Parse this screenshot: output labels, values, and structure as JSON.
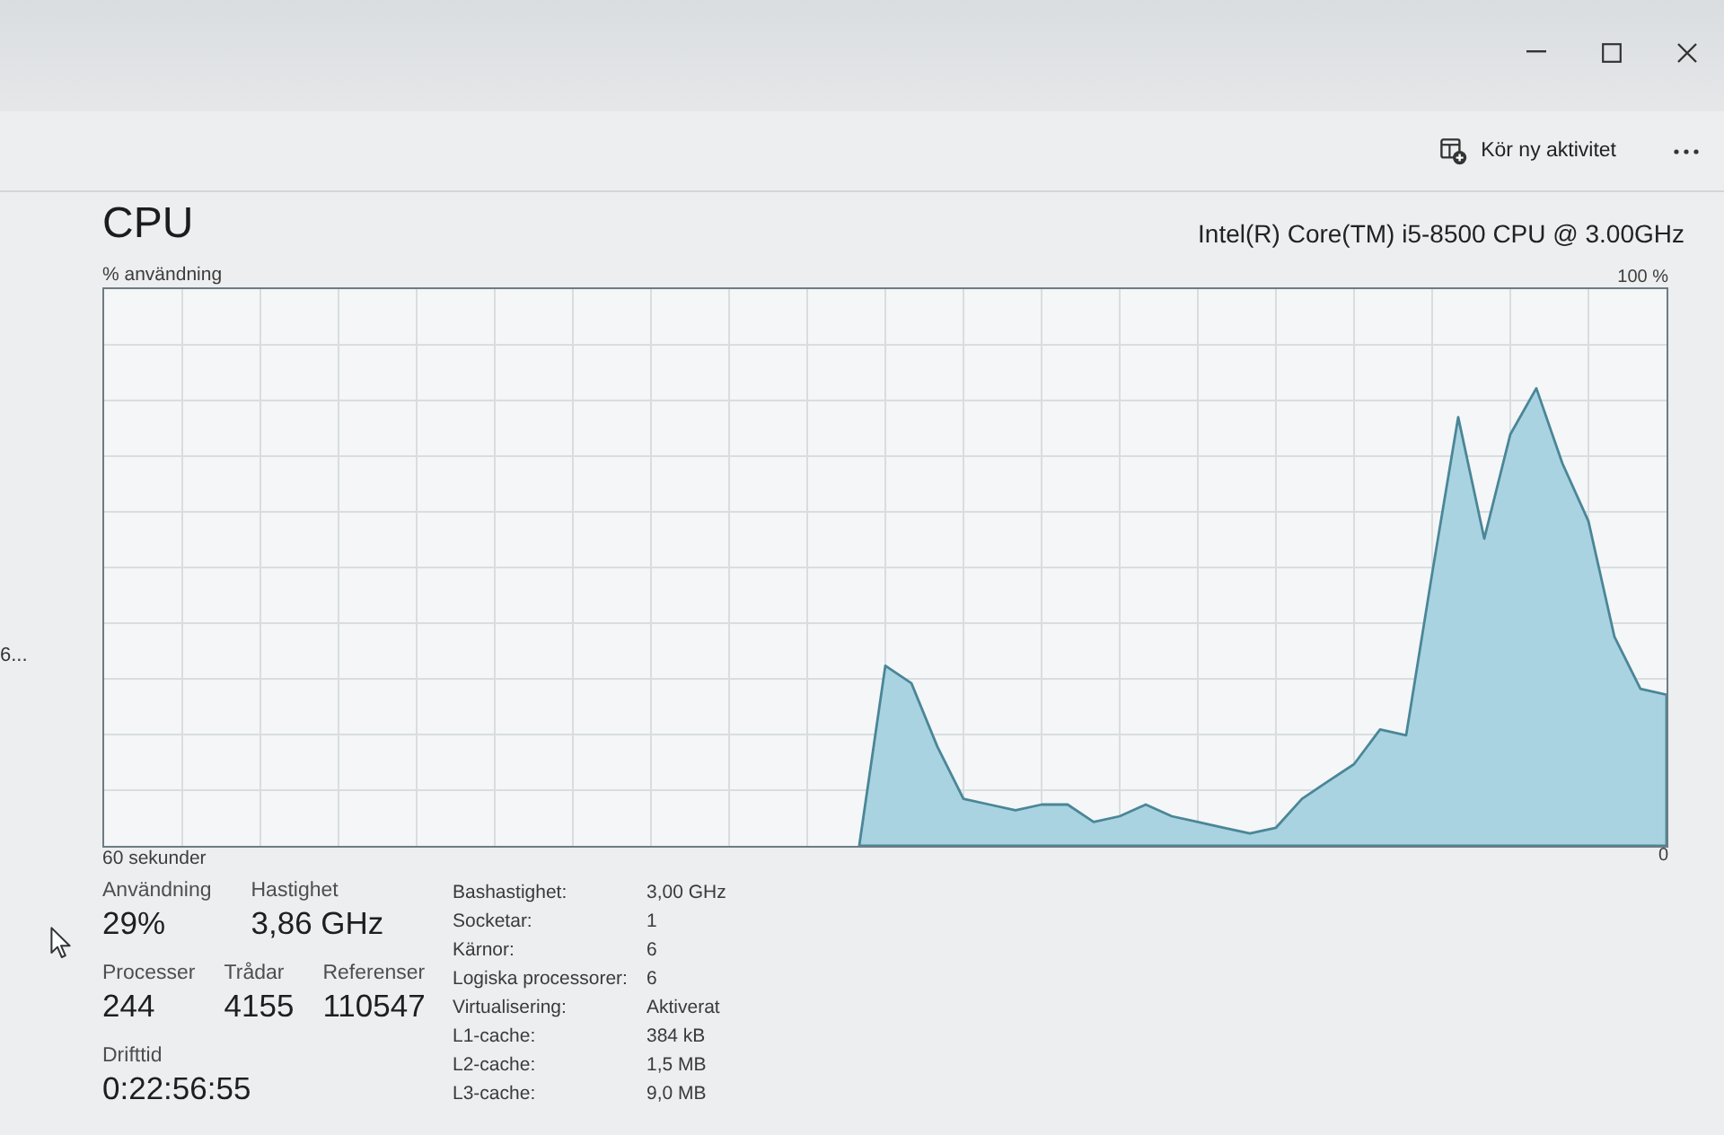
{
  "toolbar": {
    "run_task": {
      "label": "Kör ny aktivitet"
    }
  },
  "sidebar": {
    "items": [
      {
        "label": "6..."
      }
    ]
  },
  "performance": {
    "title": "CPU",
    "model": "Intel(R) Core(TM) i5-8500 CPU @ 3.00GHz",
    "chart_data": {
      "type": "area",
      "xlabel": "60 sekunder",
      "ylabel": "% användning",
      "ylim": [
        0,
        100
      ],
      "yticks": [
        {
          "value": 100,
          "label": "100 %"
        },
        {
          "value": 0,
          "label": "0"
        }
      ],
      "grid": true,
      "values": [
        null,
        null,
        null,
        null,
        null,
        null,
        null,
        null,
        null,
        null,
        null,
        null,
        null,
        null,
        null,
        null,
        null,
        null,
        null,
        null,
        null,
        null,
        null,
        null,
        null,
        null,
        null,
        null,
        null,
        2,
        33,
        30,
        19,
        10,
        9,
        8,
        9,
        9,
        6,
        7,
        9,
        7,
        6,
        5,
        4,
        5,
        10,
        13,
        16,
        22,
        21,
        49,
        76,
        55,
        73,
        81,
        68,
        58,
        38,
        29,
        28
      ]
    }
  },
  "stat_rows": [
    [
      {
        "label": "Användning",
        "value": "29%"
      },
      {
        "label": "Hastighet",
        "value": "3,86 GHz"
      }
    ],
    [
      {
        "label": "Processer",
        "value": "244"
      },
      {
        "label": "Trådar",
        "value": "4155"
      },
      {
        "label": "Referenser",
        "value": "110547"
      }
    ],
    [
      {
        "label": "Drifttid",
        "value": "0:22:56:55"
      }
    ]
  ],
  "details": [
    {
      "label": "Bashastighet:",
      "value": "3,00 GHz"
    },
    {
      "label": "Socketar:",
      "value": "1"
    },
    {
      "label": "Kärnor:",
      "value": "6"
    },
    {
      "label": "Logiska processorer:",
      "value": "6"
    },
    {
      "label": "Virtualisering:",
      "value": "Aktiverat"
    },
    {
      "label": "L1-cache:",
      "value": "384 kB"
    },
    {
      "label": "L2-cache:",
      "value": "1,5 MB"
    },
    {
      "label": "L3-cache:",
      "value": "9,0 MB"
    }
  ]
}
